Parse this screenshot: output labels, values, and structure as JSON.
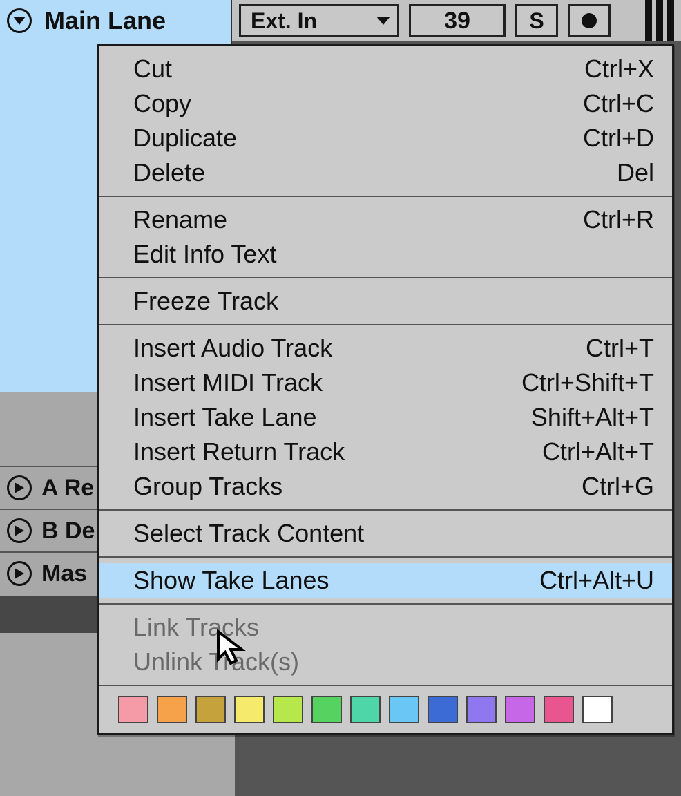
{
  "track": {
    "title": "Main Lane",
    "input_source": "Ext. In",
    "number_value": "39",
    "solo_label": "S"
  },
  "returns": [
    {
      "label": "A Re"
    },
    {
      "label": "B De"
    },
    {
      "label": "Mas"
    }
  ],
  "menu": {
    "groups": [
      [
        {
          "label": "Cut",
          "shortcut": "Ctrl+X",
          "disabled": false,
          "highlight": false
        },
        {
          "label": "Copy",
          "shortcut": "Ctrl+C",
          "disabled": false,
          "highlight": false
        },
        {
          "label": "Duplicate",
          "shortcut": "Ctrl+D",
          "disabled": false,
          "highlight": false
        },
        {
          "label": "Delete",
          "shortcut": "Del",
          "disabled": false,
          "highlight": false
        }
      ],
      [
        {
          "label": "Rename",
          "shortcut": "Ctrl+R",
          "disabled": false,
          "highlight": false
        },
        {
          "label": "Edit Info Text",
          "shortcut": "",
          "disabled": false,
          "highlight": false
        }
      ],
      [
        {
          "label": "Freeze Track",
          "shortcut": "",
          "disabled": false,
          "highlight": false
        }
      ],
      [
        {
          "label": "Insert Audio Track",
          "shortcut": "Ctrl+T",
          "disabled": false,
          "highlight": false
        },
        {
          "label": "Insert MIDI Track",
          "shortcut": "Ctrl+Shift+T",
          "disabled": false,
          "highlight": false
        },
        {
          "label": "Insert Take Lane",
          "shortcut": "Shift+Alt+T",
          "disabled": false,
          "highlight": false
        },
        {
          "label": "Insert Return Track",
          "shortcut": "Ctrl+Alt+T",
          "disabled": false,
          "highlight": false
        },
        {
          "label": "Group Tracks",
          "shortcut": "Ctrl+G",
          "disabled": false,
          "highlight": false
        }
      ],
      [
        {
          "label": "Select Track Content",
          "shortcut": "",
          "disabled": false,
          "highlight": false
        }
      ],
      [
        {
          "label": "Show Take Lanes",
          "shortcut": "Ctrl+Alt+U",
          "disabled": false,
          "highlight": true
        }
      ],
      [
        {
          "label": "Link Tracks",
          "shortcut": "",
          "disabled": true,
          "highlight": false
        },
        {
          "label": "Unlink Track(s)",
          "shortcut": "",
          "disabled": true,
          "highlight": false
        }
      ]
    ]
  },
  "colors": [
    "#f59aa7",
    "#f5a24b",
    "#c6a23d",
    "#f5ea6b",
    "#b6e84b",
    "#55d260",
    "#4fd6a8",
    "#6ac6f5",
    "#3d6bd6",
    "#8f77f0",
    "#c667e8",
    "#e8558f",
    "#ffffff"
  ]
}
